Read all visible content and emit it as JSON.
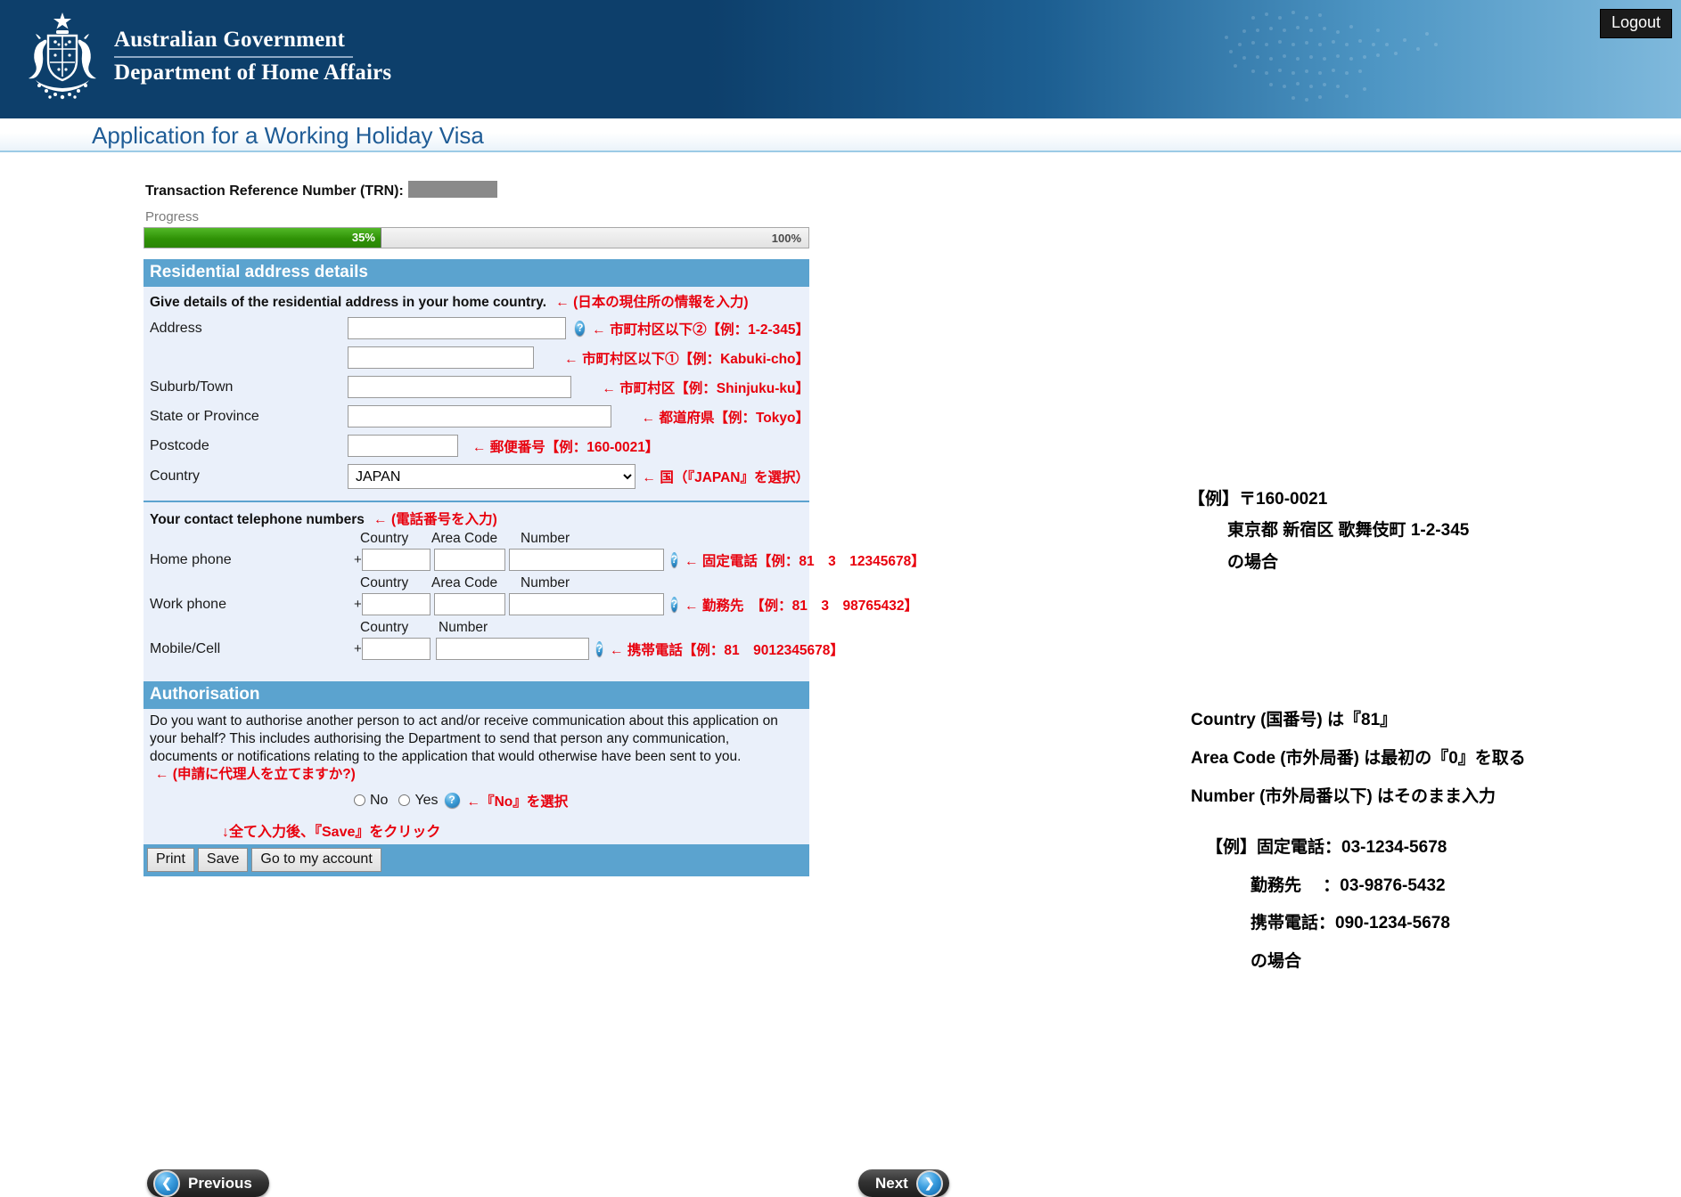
{
  "header": {
    "logout_label": "Logout",
    "gov_line1": "Australian Government",
    "gov_line2": "Department of Home Affairs",
    "page_title": "Application for a Working Holiday Visa",
    "crest_icon": "australian-coat-of-arms",
    "map_icon": "australia-map-dots"
  },
  "trn": {
    "label": "Transaction Reference Number (TRN):",
    "value_masked": ""
  },
  "progress": {
    "label": "Progress",
    "percent_label": "35%",
    "max_label": "100%",
    "percent_value": 35,
    "fill_color": "#2f9206"
  },
  "residential": {
    "section_title": "Residential address details",
    "intro": "Give details of the residential address in your home country.",
    "intro_annotation": "← (日本の現住所の情報を入力)",
    "fields": {
      "address_label": "Address",
      "address1_value": "",
      "address1_annotation": "← 市町村区以下②【例：1-2-345】",
      "address2_value": "",
      "address2_annotation": "← 市町村区以下①【例：Kabuki-cho】",
      "suburb_label": "Suburb/Town",
      "suburb_value": "",
      "suburb_annotation": "← 市町村区【例：Shinjuku-ku】",
      "state_label": "State or Province",
      "state_value": "",
      "state_annotation": "← 都道府県【例：Tokyo】",
      "postcode_label": "Postcode",
      "postcode_value": "",
      "postcode_annotation": "← 郵便番号【例：160-0021】",
      "country_label": "Country",
      "country_value": "JAPAN",
      "country_annotation": "← 国（『JAPAN』を選択）"
    },
    "help_icon": "question-mark-icon"
  },
  "phones": {
    "heading": "Your contact telephone numbers",
    "heading_annotation": "← (電話番号を入力)",
    "col_country": "Country",
    "col_area": "Area Code",
    "col_number": "Number",
    "home_label": "Home phone",
    "home_annotation": "← 固定電話【例：81　3　12345678】",
    "work_label": "Work phone",
    "work_annotation": "← 勤務先　【例：81　3　98765432】",
    "mobile_label": "Mobile/Cell",
    "mobile_annotation": "← 携帯電話【例：81　9012345678】",
    "plus_sign": "+",
    "home_country_value": "",
    "home_area_value": "",
    "home_number_value": "",
    "work_country_value": "",
    "work_area_value": "",
    "work_number_value": "",
    "mobile_country_value": "",
    "mobile_number_value": ""
  },
  "authorisation": {
    "section_title": "Authorisation",
    "question": "Do you want to authorise another person to act and/or receive communication about this application on your behalf? This includes authorising the Department to send that person any communication, documents or notifications relating to the application that would otherwise have been sent to you.",
    "question_annotation": "← (申請に代理人を立てますか?)",
    "option_no": "No",
    "option_yes": "Yes",
    "radio_annotation": "←『No』を選択",
    "save_note": "↓全て入力後、『Save』をクリック"
  },
  "toolbar": {
    "print_label": "Print",
    "save_label": "Save",
    "account_label": "Go to my account"
  },
  "nav": {
    "previous_label": "Previous",
    "next_label": "Next",
    "prev_icon": "chevron-left-icon",
    "next_icon": "chevron-right-icon"
  },
  "side_notes": {
    "address_example": [
      "【例】〒160-0021",
      "東京都 新宿区 歌舞伎町 1-2-345",
      "の場合"
    ],
    "phone_rules": [
      "Country (国番号) は『81』",
      "Area Code (市外局番) は最初の『0』を取る",
      "Number (市外局番以下) はそのまま入力"
    ],
    "phone_example": [
      "【例】固定電話：03-1234-5678",
      "勤務先　 ：03-9876-5432",
      "携帯電話：090-1234-5678",
      "の場合"
    ]
  },
  "colors": {
    "banner_blue": "#0d3f6b",
    "section_blue": "#5ba3cf",
    "annotation_red": "#e8000d",
    "title_blue": "#1f5c96"
  }
}
